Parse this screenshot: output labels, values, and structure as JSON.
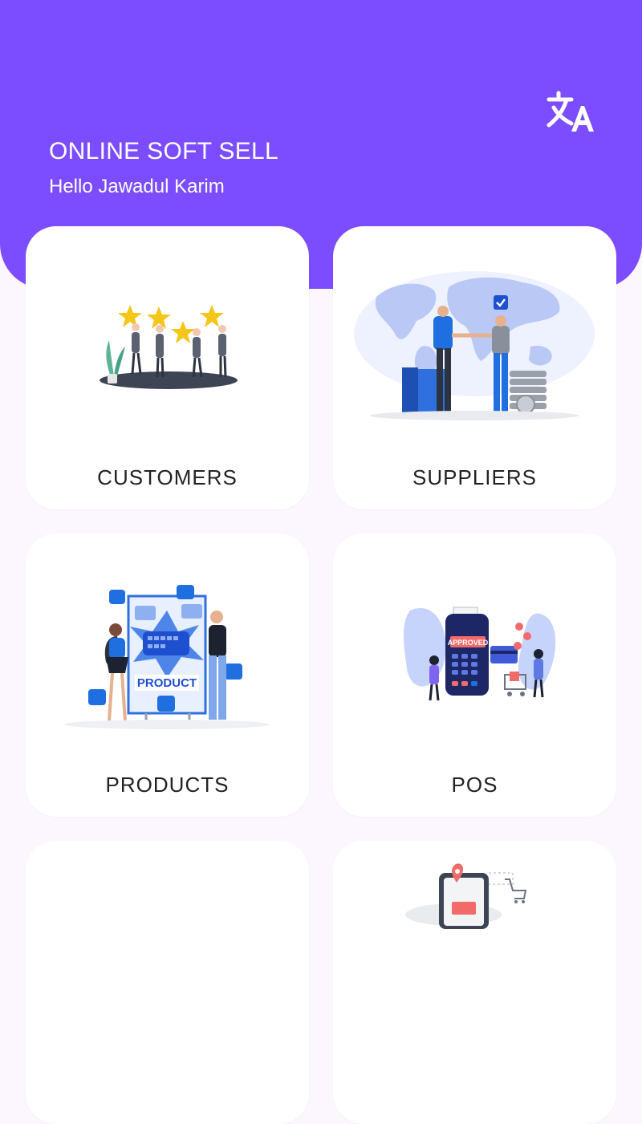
{
  "header": {
    "app_title": "ONLINE SOFT SELL",
    "greeting": "Hello Jawadul Karim",
    "translate_icon": "translate-icon",
    "background_color": "#7c4dff"
  },
  "menu": {
    "items": [
      {
        "label": "CUSTOMERS",
        "icon": "customers-illustration"
      },
      {
        "label": "SUPPLIERS",
        "icon": "suppliers-illustration"
      },
      {
        "label": "PRODUCTS",
        "icon": "products-illustration"
      },
      {
        "label": "POS",
        "icon": "pos-illustration"
      },
      {
        "label": "",
        "icon": "blank-illustration"
      },
      {
        "label": "",
        "icon": "delivery-illustration"
      }
    ]
  },
  "colors": {
    "accent": "#7c4dff",
    "page_background": "#fcf7ff",
    "card_background": "#ffffff"
  }
}
